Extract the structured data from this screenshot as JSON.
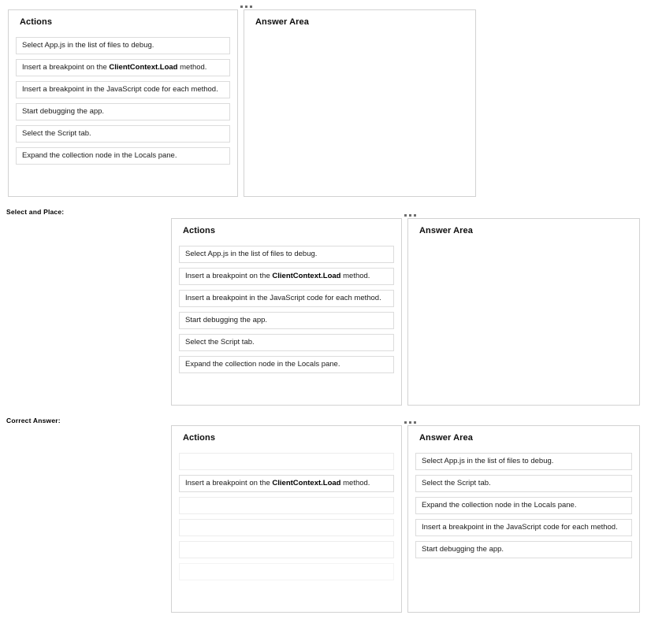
{
  "labels": {
    "select_and_place": "Select and Place:",
    "correct_answer": "Correct Answer:"
  },
  "panel_titles": {
    "actions": "Actions",
    "answer_area": "Answer Area"
  },
  "icons": {
    "drag_handle": "ellipsis-dots-icon"
  },
  "colors": {
    "page_background": "#ffffff",
    "panel_border": "#d2d2d2",
    "item_border": "#dcdcdc",
    "empty_item_border": "#ededed",
    "text": "#1a1a1a"
  },
  "question1": {
    "actions": [
      {
        "text": "Select App.js in the list of files to debug.",
        "bold": "",
        "empty": false
      },
      {
        "text": "Insert a breakpoint on the ClientContext.Load method.",
        "bold": "ClientContext.Load",
        "empty": false
      },
      {
        "text": "Insert a breakpoint in the JavaScript code for each method.",
        "bold": "",
        "empty": false
      },
      {
        "text": "Start debugging the app.",
        "bold": "",
        "empty": false
      },
      {
        "text": "Select the Script tab.",
        "bold": "",
        "empty": false
      },
      {
        "text": "Expand the collection node in the Locals pane.",
        "bold": "",
        "empty": false
      }
    ],
    "answer_area": []
  },
  "question2": {
    "actions": [
      {
        "text": "Select App.js in the list of files to debug.",
        "bold": "",
        "empty": false
      },
      {
        "text": "Insert a breakpoint on the ClientContext.Load method.",
        "bold": "ClientContext.Load",
        "empty": false
      },
      {
        "text": "Insert a breakpoint in the JavaScript code for each method.",
        "bold": "",
        "empty": false
      },
      {
        "text": "Start debugging the app.",
        "bold": "",
        "empty": false
      },
      {
        "text": "Select the Script tab.",
        "bold": "",
        "empty": false
      },
      {
        "text": "Expand the collection node in the Locals pane.",
        "bold": "",
        "empty": false
      }
    ],
    "answer_area": []
  },
  "question3": {
    "actions": [
      {
        "text": "",
        "bold": "",
        "empty": true
      },
      {
        "text": "Insert a breakpoint on the ClientContext.Load method.",
        "bold": "ClientContext.Load",
        "empty": false
      },
      {
        "text": "",
        "bold": "",
        "empty": true
      },
      {
        "text": "",
        "bold": "",
        "empty": true
      },
      {
        "text": "",
        "bold": "",
        "empty": true
      },
      {
        "text": "",
        "bold": "",
        "empty": true,
        "faint": true
      }
    ],
    "answer_area": [
      {
        "text": "Select App.js in the list of files to debug.",
        "bold": "",
        "empty": false
      },
      {
        "text": "Select the Script tab.",
        "bold": "",
        "empty": false
      },
      {
        "text": "Expand the collection node in the Locals pane.",
        "bold": "",
        "empty": false
      },
      {
        "text": "Insert a breakpoint in the JavaScript code for each method.",
        "bold": "",
        "empty": false
      },
      {
        "text": "Start debugging the app.",
        "bold": "",
        "empty": false
      }
    ]
  }
}
